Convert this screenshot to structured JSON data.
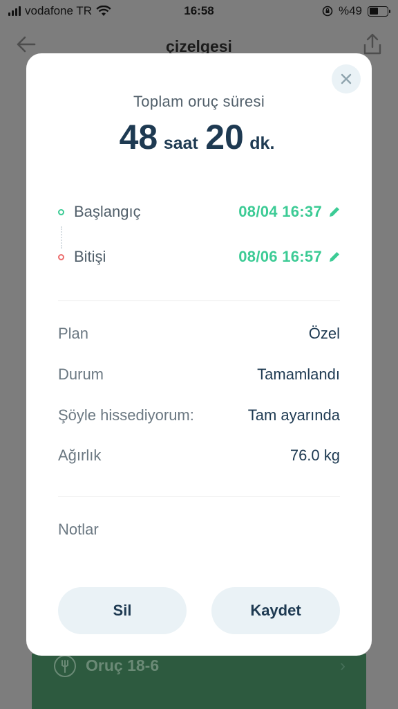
{
  "status_bar": {
    "carrier": "vodafone TR",
    "time": "16:58",
    "battery": "%49",
    "battery_level": 0.49
  },
  "nav": {
    "title": "çizelgesi",
    "back_icon": "arrow-left-icon",
    "share_icon": "share-icon"
  },
  "background_card": {
    "label": "Oruç 18-6",
    "icon": "fork-icon"
  },
  "modal": {
    "total_label": "Toplam oruç süresi",
    "total_hours": "48",
    "hours_unit": "saat",
    "total_minutes": "20",
    "minutes_unit": "dk.",
    "start": {
      "label": "Başlangıç",
      "value": "08/04 16:37"
    },
    "end": {
      "label": "Bitişi",
      "value": "08/06 16:57"
    },
    "details": [
      {
        "label": "Plan",
        "value": "Özel"
      },
      {
        "label": "Durum",
        "value": "Tamamlandı"
      },
      {
        "label": "Şöyle hissediyorum:",
        "value": "Tam ayarında"
      },
      {
        "label": "Ağırlık",
        "value": "76.0 kg"
      }
    ],
    "notes_label": "Notlar",
    "delete_label": "Sil",
    "save_label": "Kaydet"
  },
  "colors": {
    "accent_green": "#3ccb95",
    "accent_red": "#ec6d6d",
    "text_dark": "#1e3a52",
    "overlay": "#7d7d7d"
  }
}
